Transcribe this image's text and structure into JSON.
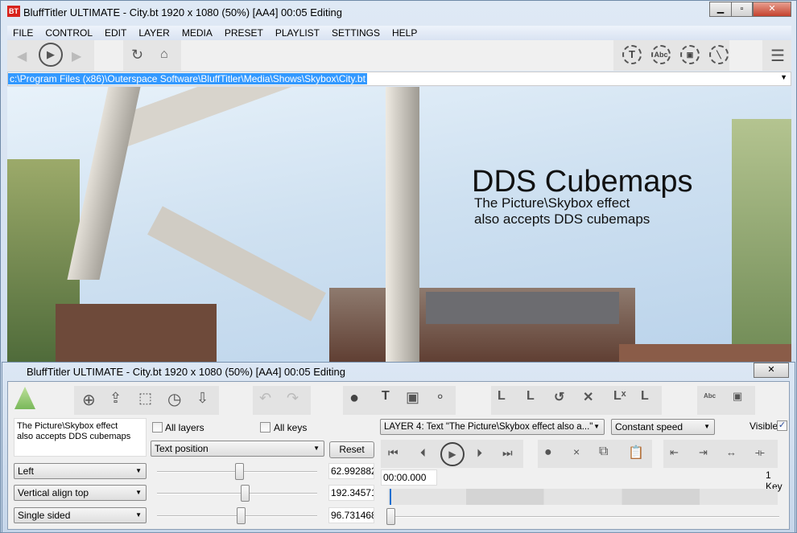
{
  "window": {
    "title": "BluffTitler ULTIMATE  - City.bt 1920 x 1080 (50%) [AA4] 00:05 Editing",
    "logo": "BT",
    "minimize": "▁",
    "maximize": "▫",
    "close": "✕"
  },
  "menu": [
    "FILE",
    "CONTROL",
    "EDIT",
    "LAYER",
    "MEDIA",
    "PRESET",
    "PLAYLIST",
    "SETTINGS",
    "HELP"
  ],
  "toolbar": {
    "icons": [
      "back-icon",
      "play-icon",
      "forward-icon",
      "refresh-icon",
      "home-icon",
      "text-layer-icon",
      "abc-icon",
      "picture-icon",
      "line-icon",
      "menu-icon"
    ],
    "abc": "Abc",
    "t": "T"
  },
  "address": {
    "value": "c:\\Program Files (x86)\\Outerspace Software\\BluffTitler\\Media\\Shows\\Skybox\\City.bt"
  },
  "preview": {
    "title": "DDS Cubemaps",
    "subtitle": "The Picture\\Skybox effect\nalso accepts DDS cubemaps"
  },
  "panel": {
    "title": "BluffTitler ULTIMATE  - City.bt 1920 x 1080 (50%) [AA4] 00:05 Editing",
    "text_content": "The Picture\\Skybox effect\nalso accepts DDS cubemaps",
    "all_layers": "All layers",
    "all_keys": "All keys",
    "property": "Text position",
    "reset": "Reset",
    "rows": [
      {
        "combo": "Left",
        "value": "62.992882",
        "slider": 0.5
      },
      {
        "combo": "Vertical align top",
        "value": "192.34571",
        "slider": 0.52
      },
      {
        "combo": "Single sided",
        "value": "96.731468",
        "slider": 0.51
      }
    ],
    "layer": "LAYER 4: Text \"The Picture\\Skybox effect also a...\"",
    "speed": "Constant speed",
    "visible": "Visible",
    "visible_checked": true,
    "time": "00:00.000",
    "keys": "1 Key",
    "timeline_position": 0
  }
}
